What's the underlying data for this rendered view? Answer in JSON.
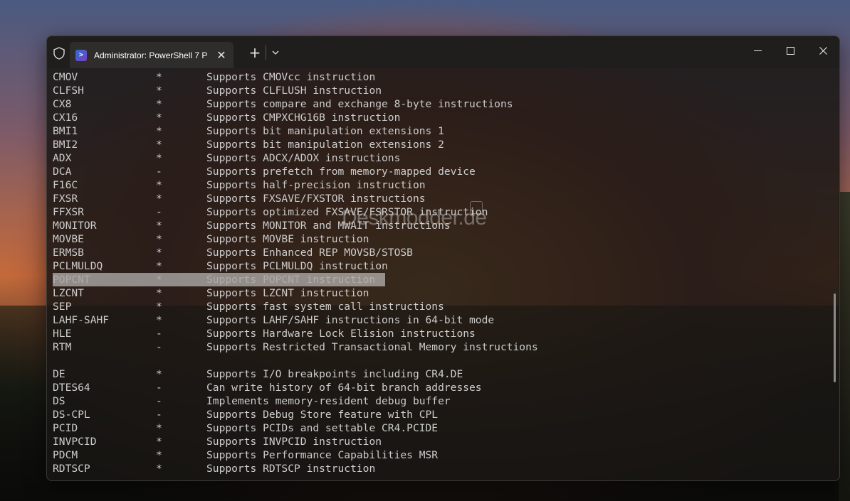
{
  "window": {
    "tab_title": "Administrator: PowerShell 7 P",
    "tab_icon": "powershell-icon"
  },
  "watermark": "Deskmodder.de",
  "terminal": {
    "rows": [
      {
        "name": "CMOV",
        "flag": "*",
        "desc": "Supports CMOVcc instruction"
      },
      {
        "name": "CLFSH",
        "flag": "*",
        "desc": "Supports CLFLUSH instruction"
      },
      {
        "name": "CX8",
        "flag": "*",
        "desc": "Supports compare and exchange 8-byte instructions"
      },
      {
        "name": "CX16",
        "flag": "*",
        "desc": "Supports CMPXCHG16B instruction"
      },
      {
        "name": "BMI1",
        "flag": "*",
        "desc": "Supports bit manipulation extensions 1"
      },
      {
        "name": "BMI2",
        "flag": "*",
        "desc": "Supports bit manipulation extensions 2"
      },
      {
        "name": "ADX",
        "flag": "*",
        "desc": "Supports ADCX/ADOX instructions"
      },
      {
        "name": "DCA",
        "flag": "-",
        "desc": "Supports prefetch from memory-mapped device"
      },
      {
        "name": "F16C",
        "flag": "*",
        "desc": "Supports half-precision instruction"
      },
      {
        "name": "FXSR",
        "flag": "*",
        "desc": "Supports FXSAVE/FXSTOR instructions"
      },
      {
        "name": "FFXSR",
        "flag": "-",
        "desc": "Supports optimized FXSAVE/FSRSTOR instruction"
      },
      {
        "name": "MONITOR",
        "flag": "*",
        "desc": "Supports MONITOR and MWAIT instructions"
      },
      {
        "name": "MOVBE",
        "flag": "*",
        "desc": "Supports MOVBE instruction"
      },
      {
        "name": "ERMSB",
        "flag": "*",
        "desc": "Supports Enhanced REP MOVSB/STOSB"
      },
      {
        "name": "PCLMULDQ",
        "flag": "*",
        "desc": "Supports PCLMULDQ instruction"
      },
      {
        "name": "POPCNT",
        "flag": "*",
        "desc": "Supports POPCNT instruction"
      },
      {
        "name": "LZCNT",
        "flag": "*",
        "desc": "Supports LZCNT instruction"
      },
      {
        "name": "SEP",
        "flag": "*",
        "desc": "Supports fast system call instructions"
      },
      {
        "name": "LAHF-SAHF",
        "flag": "*",
        "desc": "Supports LAHF/SAHF instructions in 64-bit mode"
      },
      {
        "name": "HLE",
        "flag": "-",
        "desc": "Supports Hardware Lock Elision instructions"
      },
      {
        "name": "RTM",
        "flag": "-",
        "desc": "Supports Restricted Transactional Memory instructions"
      },
      {
        "name": "",
        "flag": "",
        "desc": ""
      },
      {
        "name": "DE",
        "flag": "*",
        "desc": "Supports I/O breakpoints including CR4.DE"
      },
      {
        "name": "DTES64",
        "flag": "-",
        "desc": "Can write history of 64-bit branch addresses"
      },
      {
        "name": "DS",
        "flag": "-",
        "desc": "Implements memory-resident debug buffer"
      },
      {
        "name": "DS-CPL",
        "flag": "-",
        "desc": "Supports Debug Store feature with CPL"
      },
      {
        "name": "PCID",
        "flag": "*",
        "desc": "Supports PCIDs and settable CR4.PCIDE"
      },
      {
        "name": "INVPCID",
        "flag": "*",
        "desc": "Supports INVPCID instruction"
      },
      {
        "name": "PDCM",
        "flag": "*",
        "desc": "Supports Performance Capabilities MSR"
      },
      {
        "name": "RDTSCP",
        "flag": "*",
        "desc": "Supports RDTSCP instruction"
      }
    ],
    "selected_row": 15
  }
}
